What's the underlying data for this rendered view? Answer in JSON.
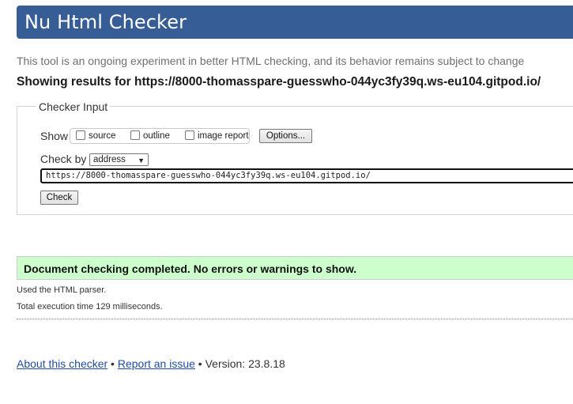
{
  "header": {
    "title": "Nu Html Checker"
  },
  "subtitle": "This tool is an ongoing experiment in better HTML checking, and its behavior remains subject to change",
  "results_for": "Showing results for https://8000-thomasspare-guesswho-044yc3fy39q.ws-eu104.gitpod.io/",
  "checker_input": {
    "legend": "Checker Input",
    "show_label": "Show",
    "options": [
      {
        "label": "source",
        "checked": false
      },
      {
        "label": "outline",
        "checked": false
      },
      {
        "label": "image report",
        "checked": false
      }
    ],
    "options_button": "Options...",
    "check_by_label": "Check by",
    "check_by_value": "address",
    "url_value": "https://8000-thomasspare-guesswho-044yc3fy39q.ws-eu104.gitpod.io/",
    "check_button": "Check"
  },
  "status": {
    "message": "Document checking completed. No errors or warnings to show.",
    "color": "#ccffcc"
  },
  "info": {
    "parser": "Used the HTML parser.",
    "time": "Total execution time 129 milliseconds."
  },
  "footer": {
    "about_link": "About this checker",
    "sep1": " • ",
    "report_link": "Report an issue",
    "version_text": " • Version: 23.8.18"
  },
  "colors": {
    "header_bg": "#365d95",
    "link": "#1f4ea1"
  }
}
